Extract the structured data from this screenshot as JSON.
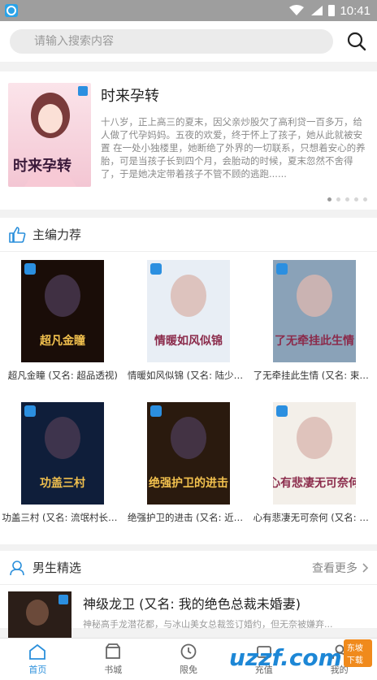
{
  "status_bar": {
    "time": "10:41"
  },
  "search": {
    "placeholder": "请输入搜索内容"
  },
  "featured": {
    "title": "时来孕转",
    "description": "十八岁，正上高三的夏末，因父亲炒股欠了高利贷一百多万，给人做了代孕妈妈。五夜的欢爱，终于怀上了孩子，她从此就被安置 在一处小独楼里，她断绝了外界的一切联系，只想着安心的养胎，可是当孩子长到四个月，会胎动的时候，夏末忽然不舍得了，于是她决定带着孩子不管不顾的逃跑......",
    "cover_text": "时来孕转",
    "dots": 5,
    "active_dot": 0
  },
  "editor_picks": {
    "title": "主编力荐",
    "books": [
      {
        "title": "超凡金瞳 (又名: 超品透视)",
        "cover_text": "超凡金瞳",
        "cover_color": "#1a0d08"
      },
      {
        "title": "情暖如风似锦 (又名: 陆少的...",
        "cover_text": "情暖如风似锦",
        "cover_color": "#e8eef5"
      },
      {
        "title": "了无牵挂此生情 (又名: 束手...",
        "cover_text": "了无牵挂此生情",
        "cover_color": "#8aa2b8"
      },
      {
        "title": "功盖三村 (又名: 流氓村长的...",
        "cover_text": "功盖三村",
        "cover_color": "#0f1e3a"
      },
      {
        "title": "绝强护卫的进击 (又名: 近身...",
        "cover_text": "绝强护卫的进击",
        "cover_color": "#2a1a0e"
      },
      {
        "title": "心有悲凄无可奈何 (又名: 此...",
        "cover_text": "心有悲凄无可奈何",
        "cover_color": "#f3efe9"
      }
    ]
  },
  "boys_picks": {
    "title": "男生精选",
    "more_label": "查看更多",
    "item": {
      "title": "神级龙卫 (又名: 我的绝色总裁未婚妻)",
      "desc": "神秘高手龙潜花都，与冰山美女总裁签订婚约，但无奈被嫌弃..."
    }
  },
  "tabs": [
    {
      "label": "首页",
      "icon": "home-icon",
      "active": true
    },
    {
      "label": "书城",
      "icon": "bookstore-icon",
      "active": false
    },
    {
      "label": "限免",
      "icon": "clock-icon",
      "active": false
    },
    {
      "label": "充值",
      "icon": "wallet-icon",
      "active": false
    },
    {
      "label": "我的",
      "icon": "user-icon",
      "active": false
    }
  ],
  "watermark": {
    "logo": "uzzf.com",
    "badge": "东坡下载"
  },
  "colors": {
    "accent": "#2a8fdb",
    "status_bar": "#9e9e9e",
    "watermark": "#f08a1c"
  }
}
